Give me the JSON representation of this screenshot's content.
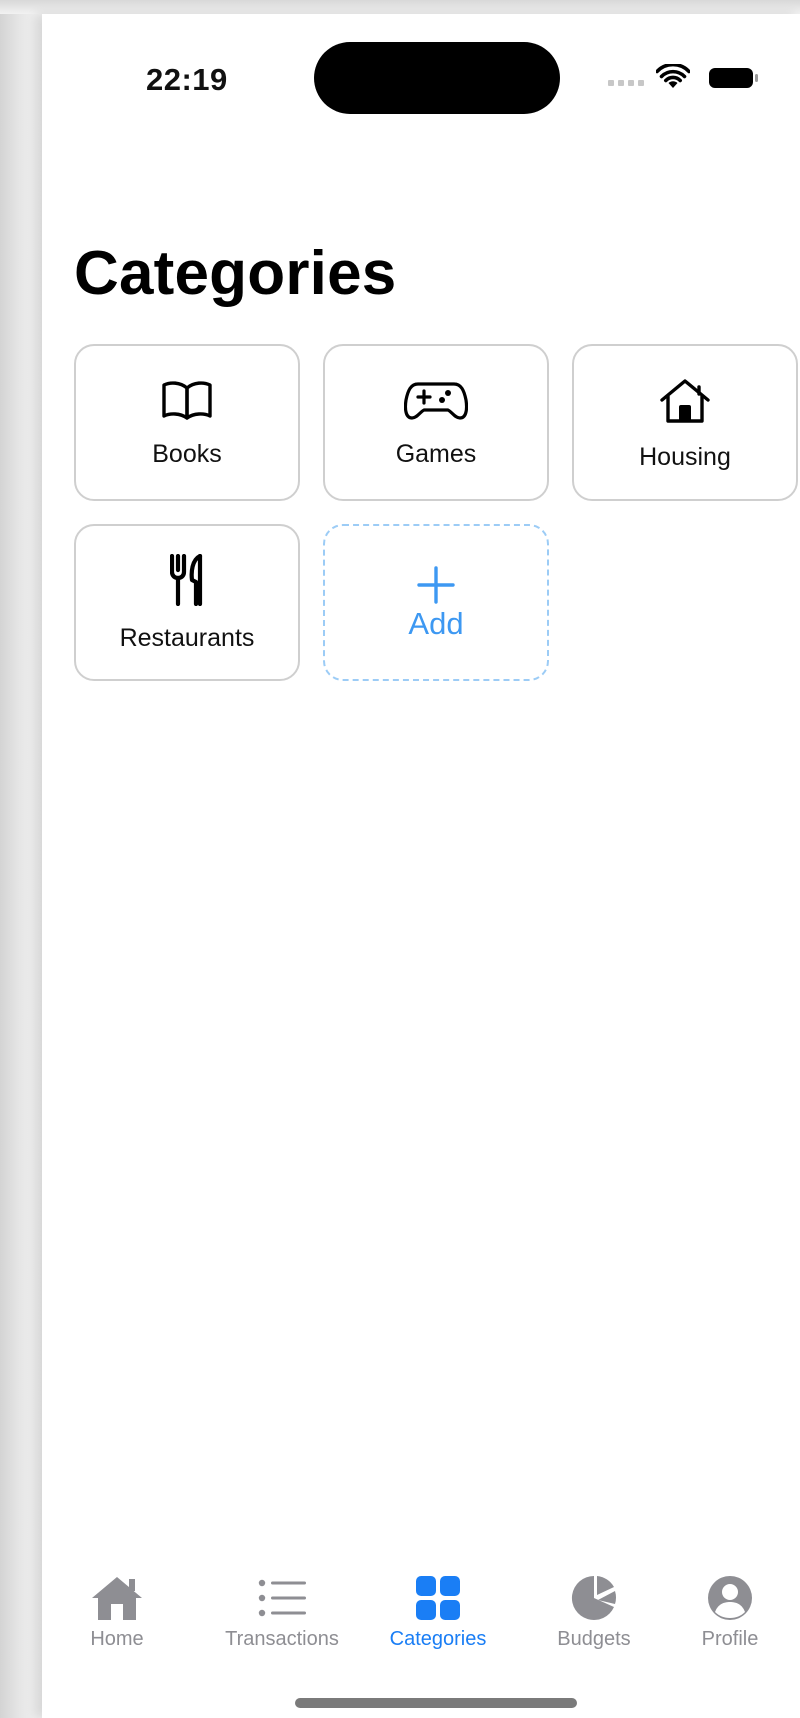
{
  "status_bar": {
    "time": "22:19",
    "icons": [
      "cellular-signal-icon",
      "wifi-icon",
      "battery-icon"
    ]
  },
  "page": {
    "title": "Categories"
  },
  "categories": [
    {
      "label": "Books",
      "icon": "book-icon"
    },
    {
      "label": "Games",
      "icon": "gamecontroller-icon"
    },
    {
      "label": "Housing",
      "icon": "house-icon"
    },
    {
      "label": "Restaurants",
      "icon": "fork-knife-icon"
    }
  ],
  "add_tile": {
    "label": "Add",
    "icon": "plus-icon"
  },
  "tabbar": {
    "active": "Categories",
    "tabs": [
      {
        "label": "Home",
        "icon": "house-fill-icon"
      },
      {
        "label": "Transactions",
        "icon": "list-bullet-icon"
      },
      {
        "label": "Categories",
        "icon": "square-grid-icon"
      },
      {
        "label": "Budgets",
        "icon": "chart-pie-icon"
      },
      {
        "label": "Profile",
        "icon": "person-circle-icon"
      }
    ]
  },
  "colors": {
    "accent": "#1A7EF5",
    "add_tile_border": "#9CCCF6",
    "add_tile_text": "#3D98F2",
    "inactive_tab": "#8E8E93",
    "card_border": "#CFCFCF"
  }
}
